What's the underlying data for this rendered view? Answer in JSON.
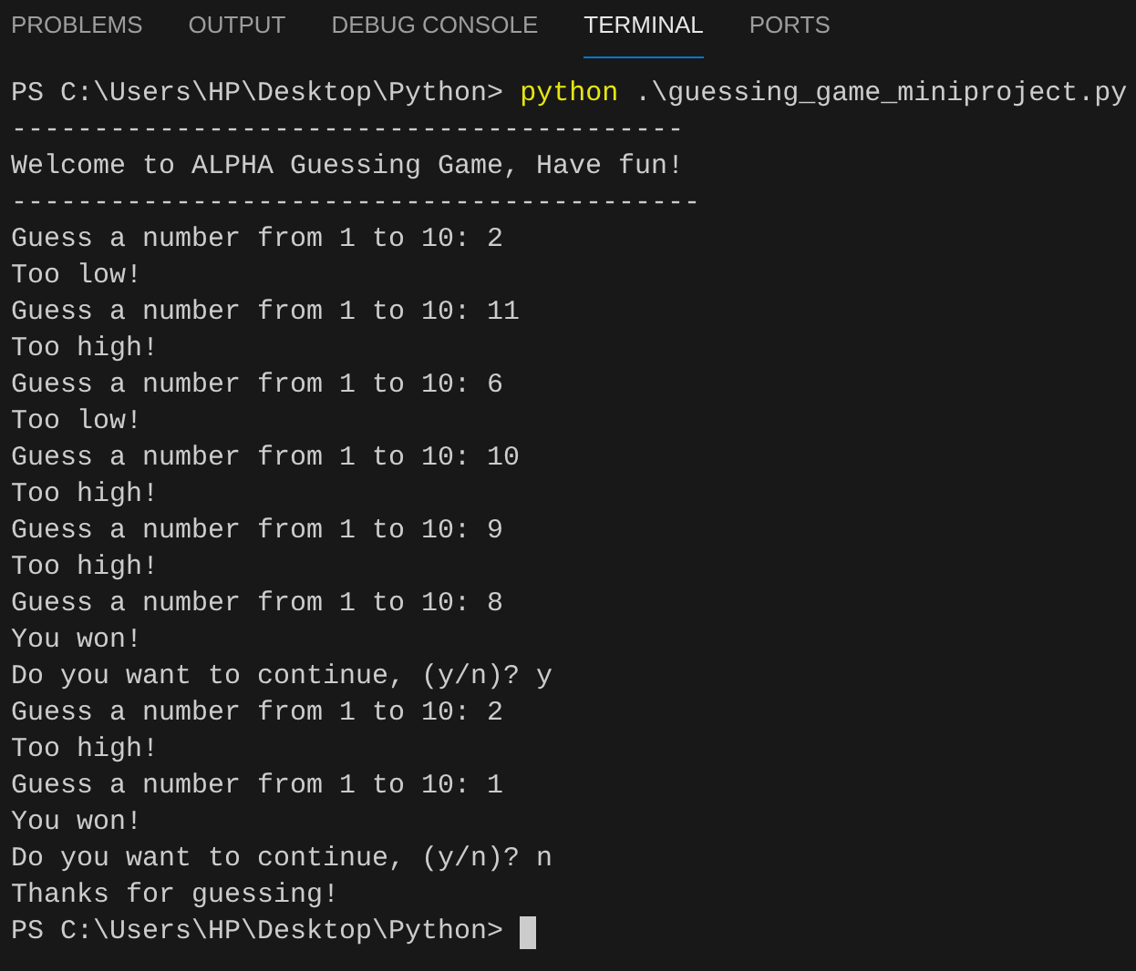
{
  "panel_tabs": [
    {
      "label": "PROBLEMS",
      "selected": false
    },
    {
      "label": "OUTPUT",
      "selected": false
    },
    {
      "label": "DEBUG CONSOLE",
      "selected": false
    },
    {
      "label": "TERMINAL",
      "selected": true
    },
    {
      "label": "PORTS",
      "selected": false
    }
  ],
  "terminal_lines": [
    {
      "kind": "command",
      "prompt": "PS C:\\Users\\HP\\Desktop\\Python>",
      "command": "python",
      "arguments": ".\\guessing_game_miniproject.py"
    },
    {
      "kind": "output",
      "text": "-----------------------------------------"
    },
    {
      "kind": "output",
      "text": "Welcome to ALPHA Guessing Game, Have fun!"
    },
    {
      "kind": "output",
      "text": "------------------------------------------"
    },
    {
      "kind": "output",
      "text": "Guess a number from 1 to 10: 2"
    },
    {
      "kind": "output",
      "text": "Too low!"
    },
    {
      "kind": "output",
      "text": "Guess a number from 1 to 10: 11"
    },
    {
      "kind": "output",
      "text": "Too high!"
    },
    {
      "kind": "output",
      "text": "Guess a number from 1 to 10: 6"
    },
    {
      "kind": "output",
      "text": "Too low!"
    },
    {
      "kind": "output",
      "text": "Guess a number from 1 to 10: 10"
    },
    {
      "kind": "output",
      "text": "Too high!"
    },
    {
      "kind": "output",
      "text": "Guess a number from 1 to 10: 9"
    },
    {
      "kind": "output",
      "text": "Too high!"
    },
    {
      "kind": "output",
      "text": "Guess a number from 1 to 10: 8"
    },
    {
      "kind": "output",
      "text": "You won!"
    },
    {
      "kind": "output",
      "text": "Do you want to continue, (y/n)? y"
    },
    {
      "kind": "output",
      "text": "Guess a number from 1 to 10: 2"
    },
    {
      "kind": "output",
      "text": "Too high!"
    },
    {
      "kind": "output",
      "text": "Guess a number from 1 to 10: 1"
    },
    {
      "kind": "output",
      "text": "You won!"
    },
    {
      "kind": "output",
      "text": "Do you want to continue, (y/n)? n"
    },
    {
      "kind": "output",
      "text": "Thanks for guessing!"
    },
    {
      "kind": "prompt",
      "prompt": "PS C:\\Users\\HP\\Desktop\\Python>"
    }
  ]
}
